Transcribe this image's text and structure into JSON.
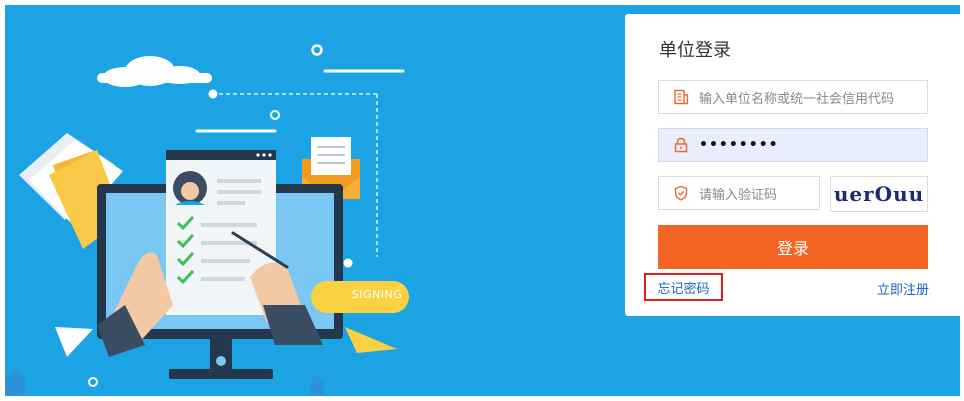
{
  "illustration": {
    "signing_label": "SIGNING"
  },
  "login": {
    "title": "单位登录",
    "company_placeholder": "输入单位名称或统一社会信用代码",
    "password_masked": "••••••••",
    "captcha_placeholder": "请输入验证码",
    "captcha_code": "uerOuu",
    "submit_label": "登录",
    "forgot_label": "忘记密码",
    "register_label": "立即注册"
  },
  "colors": {
    "background": "#1ba3e4",
    "button": "#f26522",
    "link": "#1a62c7",
    "highlight_border": "#e02020",
    "password_bg": "#e8eefb"
  }
}
